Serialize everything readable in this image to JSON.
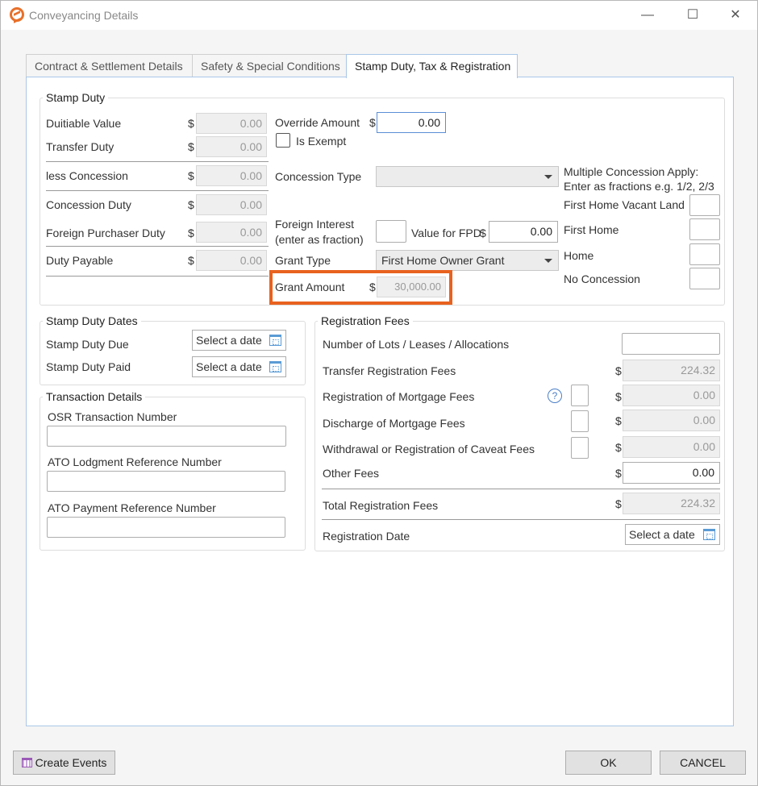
{
  "window": {
    "title": "Conveyancing Details",
    "minimize": "—",
    "maximize": "☐",
    "close": "✕"
  },
  "tabs": [
    {
      "label": "Contract & Settlement Details"
    },
    {
      "label": "Safety & Special Conditions"
    },
    {
      "label": "Stamp Duty, Tax & Registration"
    }
  ],
  "stamp_duty": {
    "legend": "Stamp Duty",
    "dutiable_value": {
      "label": "Duitiable Value",
      "value": "0.00"
    },
    "transfer_duty": {
      "label": "Transfer Duty",
      "value": "0.00"
    },
    "less_concession": {
      "label": "less Concession",
      "value": "0.00"
    },
    "concession_duty": {
      "label": "Concession Duty",
      "value": "0.00"
    },
    "foreign_purchaser_duty": {
      "label": "Foreign Purchaser Duty",
      "value": "0.00"
    },
    "duty_payable": {
      "label": "Duty Payable",
      "value": "0.00"
    },
    "override_amount": {
      "label": "Override Amount",
      "value": "0.00"
    },
    "is_exempt": {
      "label": "Is Exempt"
    },
    "concession_type": {
      "label": "Concession Type",
      "value": ""
    },
    "foreign_interest": {
      "label_line1": "Foreign Interest",
      "label_line2": "(enter as fraction)"
    },
    "value_for_fpd": {
      "label": "Value for FPD",
      "value": "0.00"
    },
    "grant_type": {
      "label": "Grant Type",
      "value": "First Home Owner Grant"
    },
    "grant_amount": {
      "label": "Grant Amount",
      "value": "30,000.00"
    },
    "multiple_concession": {
      "line1": "Multiple Concession Apply:",
      "line2": "Enter as fractions e.g. 1/2, 2/3"
    },
    "concessions": {
      "first_home_vacant_land": "First Home Vacant Land",
      "first_home": "First Home",
      "home": "Home",
      "no_concession": "No Concession"
    },
    "currency": "$"
  },
  "stamp_duty_dates": {
    "legend": "Stamp Duty Dates",
    "due_label": "Stamp Duty Due",
    "paid_label": "Stamp Duty Paid",
    "date_placeholder": "Select a date"
  },
  "transaction_details": {
    "legend": "Transaction Details",
    "osr_label": "OSR Transaction Number",
    "ato_lodgment_label": "ATO Lodgment Reference Number",
    "ato_payment_label": "ATO Payment Reference Number"
  },
  "registration_fees": {
    "legend": "Registration Fees",
    "lots_label": "Number of Lots / Leases / Allocations",
    "transfer_label": "Transfer Registration Fees",
    "transfer_value": "224.32",
    "mortgage_label": "Registration of Mortgage Fees",
    "mortgage_value": "0.00",
    "discharge_label": "Discharge of Mortgage Fees",
    "discharge_value": "0.00",
    "caveat_label": "Withdrawal or Registration of Caveat Fees",
    "caveat_value": "0.00",
    "other_label": "Other Fees",
    "other_value": "0.00",
    "total_label": "Total Registration Fees",
    "total_value": "224.32",
    "date_label": "Registration Date",
    "date_placeholder": "Select a date",
    "help": "?"
  },
  "footer": {
    "create_events": "Create Events",
    "ok": "OK",
    "cancel": "CANCEL"
  },
  "colors": {
    "highlight": "#e8621f",
    "accent": "#5a8ed6"
  }
}
